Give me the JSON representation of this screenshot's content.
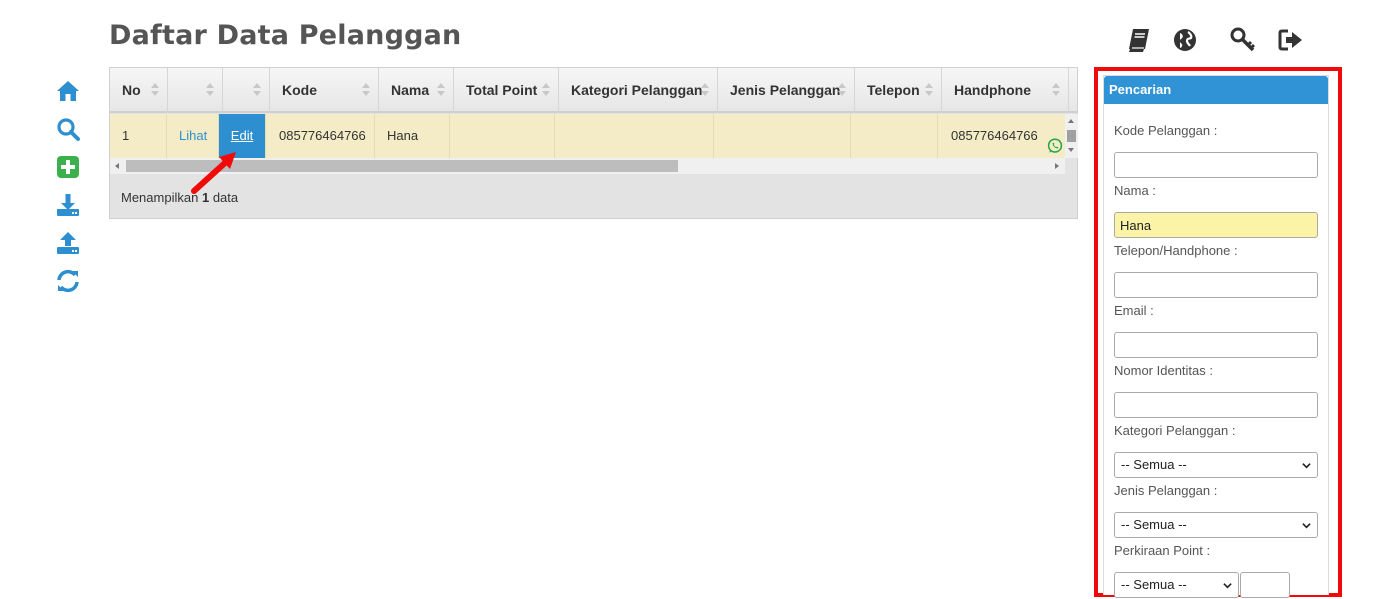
{
  "page": {
    "title": "Daftar Data Pelanggan"
  },
  "toolbar": {
    "items": [
      {
        "icon": "home-icon"
      },
      {
        "icon": "search-icon"
      },
      {
        "icon": "add-icon"
      },
      {
        "icon": "download-icon"
      },
      {
        "icon": "upload-icon"
      },
      {
        "icon": "refresh-icon"
      }
    ]
  },
  "top_icons": [
    "book-icon",
    "globe-icon",
    "key-icon",
    "logout-icon"
  ],
  "grid": {
    "columns": [
      "No",
      "",
      "",
      "Kode",
      "Nama",
      "Total Point",
      "Kategori Pelanggan",
      "Jenis Pelanggan",
      "Telepon",
      "Handphone"
    ],
    "rows": [
      {
        "no": "1",
        "view": "Lihat",
        "edit": "Edit",
        "kode": "085776464766",
        "nama": "Hana",
        "total_point": "",
        "kategori": "",
        "jenis": "",
        "telepon": "",
        "handphone": "085776464766"
      }
    ],
    "footer": {
      "prefix": "Menampilkan",
      "count": "1",
      "suffix": "data"
    }
  },
  "search": {
    "title": "Pencarian",
    "fields": {
      "kode": {
        "label": "Kode Pelanggan :",
        "value": ""
      },
      "nama": {
        "label": "Nama :",
        "value": "Hana"
      },
      "telepon": {
        "label": "Telepon/Handphone :",
        "value": ""
      },
      "email": {
        "label": "Email :",
        "value": ""
      },
      "identitas": {
        "label": "Nomor Identitas :",
        "value": ""
      },
      "kategori": {
        "label": "Kategori Pelanggan :",
        "selected": "-- Semua --"
      },
      "jenis": {
        "label": "Jenis Pelanggan :",
        "selected": "-- Semua --"
      },
      "point": {
        "label": "Perkiraan Point :",
        "selected": "-- Semua --",
        "value": ""
      }
    }
  },
  "colors": {
    "accent": "#2e8fd0",
    "row_highlight": "#f3ecc6",
    "input_filled": "#fbf4a6",
    "annotation": "#f00a0a",
    "add_icon": "#3cb04c",
    "whatsapp": "#25a244"
  }
}
